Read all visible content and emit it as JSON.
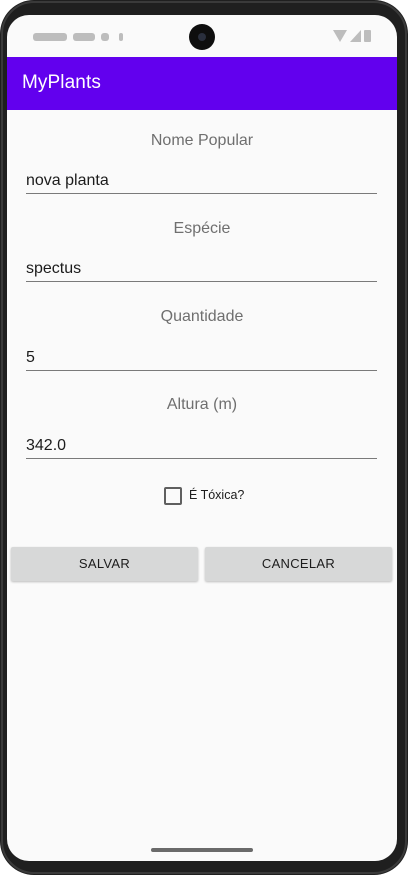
{
  "app_bar": {
    "title": "MyPlants",
    "color": "#6200ee"
  },
  "form": {
    "nome_popular": {
      "label": "Nome Popular",
      "value": "nova planta"
    },
    "especie": {
      "label": "Espécie",
      "value": "spectus"
    },
    "quantidade": {
      "label": "Quantidade",
      "value": "5"
    },
    "altura": {
      "label": "Altura (m)",
      "value": "342.0"
    },
    "toxica": {
      "label": "É Tóxica?",
      "checked": false
    }
  },
  "buttons": {
    "salvar": "SALVAR",
    "cancelar": "CANCELAR"
  },
  "status_bar": {
    "icons": [
      "wifi-icon",
      "signal-icon",
      "battery-icon"
    ]
  }
}
